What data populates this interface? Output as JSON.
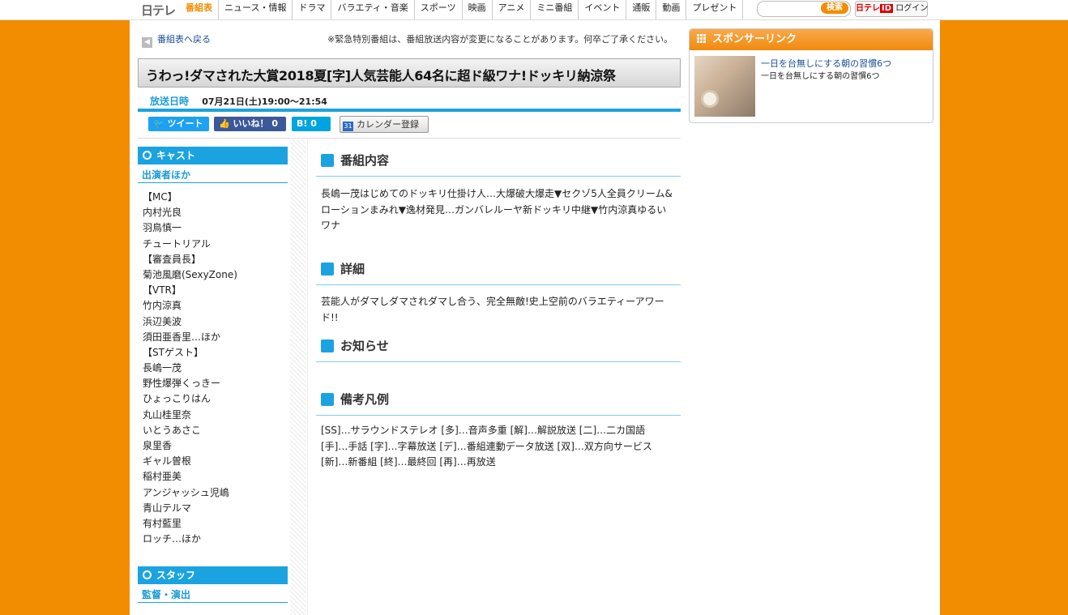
{
  "brand": {
    "logo": "日テレ"
  },
  "nav": {
    "items": [
      "番組表",
      "ニュース・情報",
      "ドラマ",
      "バラエティ・音楽",
      "スポーツ",
      "映画",
      "アニメ",
      "ミニ番組",
      "イベント",
      "通販",
      "動画",
      "プレゼント"
    ],
    "active_index": 0
  },
  "search": {
    "value": "",
    "button": "検索"
  },
  "login": {
    "brand": "日テレ",
    "id_mark": "ID",
    "label": "ログイン"
  },
  "back_link": "番組表へ戻る",
  "notice": "※緊急特別番組は、番組放送内容が変更になることがあります。何卒ご了承ください。",
  "program": {
    "title": "うわっ!ダマされた大賞2018夏[字]人気芸能人64名に超ド級ワナ!ドッキリ納涼祭",
    "air_label": "放送日時",
    "air_value": "07月21日(土)19:00～21:54"
  },
  "share": {
    "tweet": "ツイート",
    "like": "いいね！",
    "like_count": "0",
    "hatena": "B!",
    "hatena_count": "0",
    "calendar": "カレンダー登録"
  },
  "cast": {
    "heading": "キャスト",
    "subheading": "出演者ほか",
    "members": [
      "【MC】",
      "内村光良",
      "羽鳥慎一",
      "チュートリアル",
      "【審査員長】",
      "菊池風磨(SexyZone)",
      "【VTR】",
      "竹内涼真",
      "浜辺美波",
      "須田亜香里…ほか",
      "【STゲスト】",
      "長嶋一茂",
      "野性爆弾くっきー",
      "ひょっこりはん",
      "丸山桂里奈",
      "いとうあさこ",
      "泉里香",
      "ギャル曽根",
      "稲村亜美",
      "アンジャッシュ児嶋",
      "青山テルマ",
      "有村藍里",
      "ロッチ…ほか"
    ]
  },
  "staff": {
    "heading": "スタッフ",
    "subheading": "監督・演出"
  },
  "sections": {
    "content": {
      "heading": "番組内容",
      "lines": [
        "長嶋一茂はじめてのドッキリ仕掛け人…大爆破大爆走▼セクゾ5人全員クリーム&",
        "ローションまみれ▼逸材発見…ガンバレルーヤ新ドッキリ中継▼竹内涼真ゆるい",
        "ワナ"
      ]
    },
    "detail": {
      "heading": "詳細",
      "lines": [
        "芸能人がダマしダマされダマし合う、完全無敵!史上空前のバラエティーアワード!!"
      ]
    },
    "news": {
      "heading": "お知らせ"
    },
    "legend": {
      "heading": "備考凡例",
      "lines": [
        "[SS]…サラウンドステレオ [多]…音声多重 [解]…解説放送 [二]…二カ国語",
        "[手]…手話 [字]…字幕放送 [デ]…番組連動データ放送 [双]…双方向サービス",
        "[新]…新番組 [終]…最終回 [再]…再放送"
      ]
    }
  },
  "sponsor": {
    "heading": "スポンサーリンク",
    "ad_title": "一日を台無しにする朝の習慣6つ",
    "ad_desc": "一日を台無しにする朝の習慣6つ"
  }
}
